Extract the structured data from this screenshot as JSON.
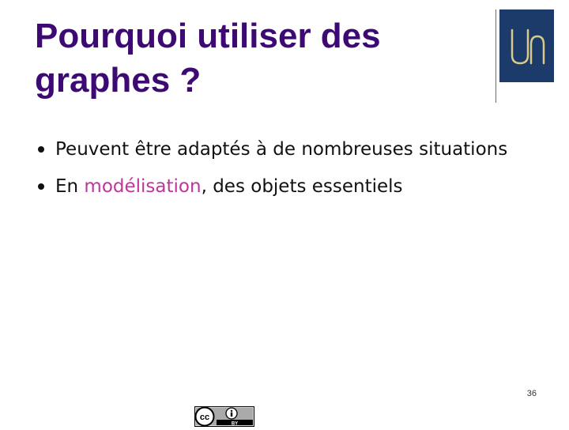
{
  "slide": {
    "title": "Pourquoi utiliser des graphes ?",
    "bullets": [
      {
        "text": "Peuvent être adaptés à de nombreuses situations"
      },
      {
        "prefix": "En ",
        "highlight": "modélisation",
        "suffix": ", des objets essentiels"
      }
    ],
    "page_number": "36"
  },
  "logo": {
    "text": "Un",
    "background_color": "#1c3b6b",
    "foreground_color": "#d9c98a"
  },
  "license": {
    "badge_icon": "creative-commons-by-icon",
    "label": "BY"
  },
  "colors": {
    "title": "#3d0a73",
    "highlight": "#c0359a",
    "text": "#111111"
  }
}
